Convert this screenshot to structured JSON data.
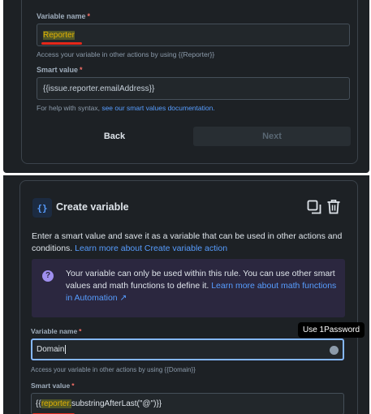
{
  "top_form": {
    "variable_name_label": "Variable name",
    "required_mark": "*",
    "variable_name_value": "Reporter",
    "variable_hint": "Access your variable in other actions by using {{Reporter}}",
    "smart_value_label": "Smart value",
    "smart_value_value": "{{issue.reporter.emailAddress}}",
    "help_prefix": "For help with syntax, ",
    "help_link": "see our smart values documentation.",
    "back_label": "Back",
    "next_label": "Next"
  },
  "create_variable": {
    "icon": "braces-icon",
    "icon_text": "{}",
    "title": "Create variable",
    "description": "Enter a smart value and save it as a variable that can be used in other actions and conditions.",
    "description_link": "Learn more about Create variable action",
    "info_icon_text": "?",
    "info_text": "Your variable can only be used within this rule. You can use other smart values and math functions to define it.",
    "info_link": "Learn more about math functions in Automation ↗",
    "variable_name_label": "Variable name",
    "required_mark": "*",
    "variable_name_value": "Domain",
    "variable_hint": "Access your variable in other actions by using {{Domain}}",
    "smart_value_label": "Smart value",
    "smart_value_prefix": "{{",
    "smart_value_highlight": "reporter.",
    "smart_value_rest": "substringAfterLast(\"@\")}}",
    "tooltip": "Use 1Password",
    "actions": [
      "copy-icon",
      "trash-icon"
    ]
  },
  "colors": {
    "panel_bg": "#1d2125",
    "accent_link": "#579dff",
    "required": "#f87168",
    "highlight_text": "#e2b203",
    "annotation_underline": "#e5271a",
    "info_bg": "#2b273f"
  }
}
